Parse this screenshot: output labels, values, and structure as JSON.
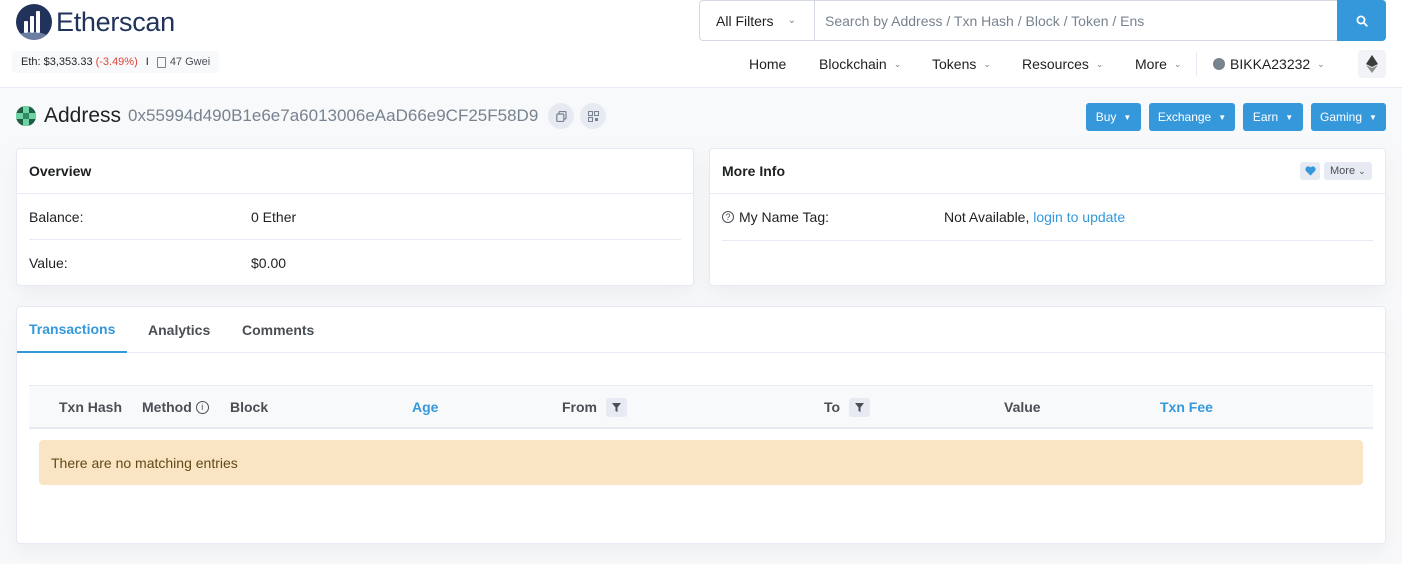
{
  "header": {
    "logo_text": "Etherscan",
    "price_label": "Eth: $3,353.33",
    "price_change": "(-3.49%)",
    "separator": "I",
    "gas": "47 Gwei",
    "search": {
      "filter_label": "All Filters",
      "placeholder": "Search by Address / Txn Hash / Block / Token / Ens"
    },
    "nav": [
      {
        "label": "Home"
      },
      {
        "label": "Blockchain"
      },
      {
        "label": "Tokens"
      },
      {
        "label": "Resources"
      },
      {
        "label": "More"
      }
    ],
    "user": "BIKKA23232"
  },
  "page": {
    "title": "Address",
    "address": "0x55994d490B1e6e7a6013006eAaD66e9CF25F58D9",
    "actions": [
      "Buy",
      "Exchange",
      "Earn",
      "Gaming"
    ]
  },
  "overview": {
    "title": "Overview",
    "balance_label": "Balance:",
    "balance_value": "0 Ether",
    "value_label": "Value:",
    "value_value": "$0.00"
  },
  "more_info": {
    "title": "More Info",
    "more_button": "More",
    "name_tag_label": "My Name Tag:",
    "name_tag_value": "Not Available,",
    "name_tag_link": "login to update"
  },
  "tabs": [
    "Transactions",
    "Analytics",
    "Comments"
  ],
  "table": {
    "columns": [
      "Txn Hash",
      "Method",
      "Block",
      "Age",
      "From",
      "To",
      "Value",
      "Txn Fee"
    ],
    "empty_message": "There are no matching entries"
  },
  "colors": {
    "accent": "#3498db",
    "brand": "#21325b",
    "negative": "#de4437",
    "empty_bg": "#f9e5c3"
  }
}
